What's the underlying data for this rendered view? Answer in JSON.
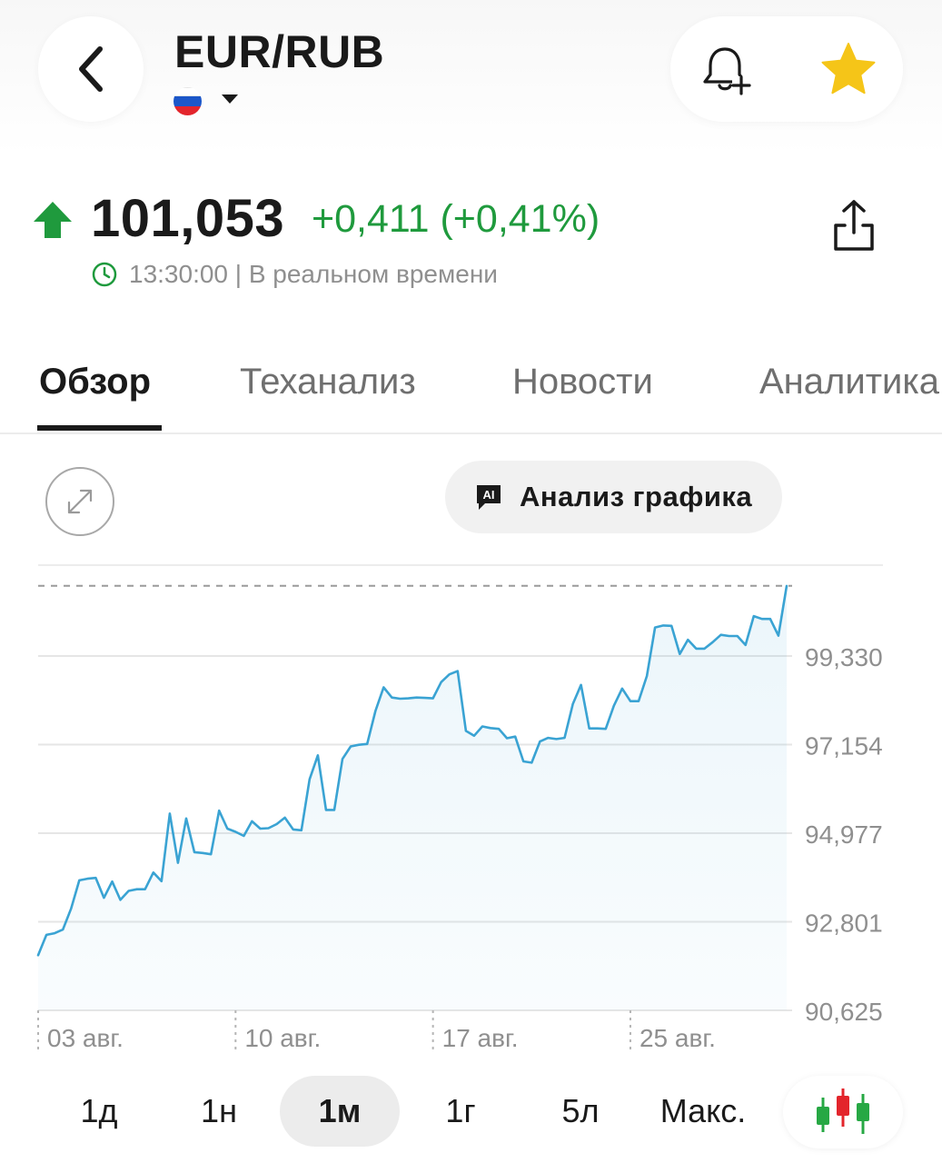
{
  "header": {
    "title": "EUR/RUB",
    "flag_colors": [
      "#ffffff",
      "#1c57c9",
      "#e3252c"
    ]
  },
  "quote": {
    "price": "101,053",
    "change": "+0,411 (+0,41%)",
    "time_status": "13:30:00 | В реальном времени",
    "up_color": "#1f9a3d"
  },
  "tabs": [
    {
      "label": "Обзор",
      "active": true
    },
    {
      "label": "Теханализ",
      "active": false
    },
    {
      "label": "Новости",
      "active": false
    },
    {
      "label": "Аналитика",
      "active": false
    }
  ],
  "ai_button": {
    "icon_text": "AI",
    "label": "Анализ графика"
  },
  "chart_data": {
    "type": "area",
    "line_color": "#3aa3d3",
    "y_ticks": [
      "99,330",
      "97,154",
      "94,977",
      "92,801",
      "90,625"
    ],
    "y_tick_values": [
      99.33,
      97.154,
      94.977,
      92.801,
      90.625
    ],
    "x_ticks": [
      "03 авг.",
      "10 авг.",
      "17 авг.",
      "25 авг."
    ],
    "x_tick_index": [
      0,
      24,
      48,
      72
    ],
    "last_value_line": 101.053,
    "ylim": [
      90.625,
      101.5
    ],
    "grid": true,
    "values": [
      91.98,
      92.48,
      92.52,
      92.61,
      93.12,
      93.82,
      93.86,
      93.88,
      93.39,
      93.79,
      93.34,
      93.56,
      93.6,
      93.6,
      94.01,
      93.8,
      95.46,
      94.25,
      95.34,
      94.51,
      94.49,
      94.46,
      95.53,
      95.09,
      95.01,
      94.91,
      95.27,
      95.09,
      95.1,
      95.2,
      95.36,
      95.07,
      95.05,
      96.3,
      96.89,
      95.55,
      95.55,
      96.8,
      97.11,
      97.15,
      97.17,
      97.98,
      98.56,
      98.31,
      98.28,
      98.29,
      98.31,
      98.3,
      98.29,
      98.69,
      98.88,
      98.96,
      97.49,
      97.37,
      97.6,
      97.56,
      97.54,
      97.31,
      97.35,
      96.74,
      96.71,
      97.23,
      97.32,
      97.29,
      97.32,
      98.15,
      98.62,
      97.55,
      97.55,
      97.54,
      98.11,
      98.53,
      98.22,
      98.22,
      98.84,
      100.03,
      100.08,
      100.07,
      99.38,
      99.73,
      99.51,
      99.51,
      99.67,
      99.85,
      99.82,
      99.82,
      99.6,
      100.31,
      100.24,
      100.24,
      99.83,
      101.05
    ]
  },
  "ranges": [
    {
      "label": "1д",
      "active": false
    },
    {
      "label": "1н",
      "active": false
    },
    {
      "label": "1м",
      "active": true
    },
    {
      "label": "1г",
      "active": false
    },
    {
      "label": "5л",
      "active": false
    },
    {
      "label": "Макс.",
      "active": false
    }
  ],
  "icons": {
    "back": "chevron-left-icon",
    "alert": "bell-plus-icon",
    "favorite": "star-icon",
    "share": "share-icon",
    "clock": "clock-icon",
    "expand": "expand-icon",
    "candles": "candlestick-icon",
    "star_color": "#f5c518"
  }
}
